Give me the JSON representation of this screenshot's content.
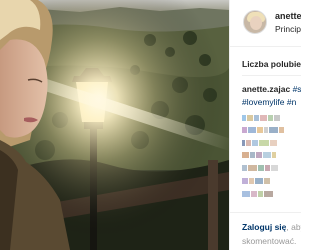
{
  "post": {
    "photo_icon": "photo",
    "header": {
      "username": "anette.z",
      "location": "Principe"
    },
    "likes_label": "Liczba polubie",
    "caption": {
      "user": "anette.zajac",
      "tag1": "#s",
      "tag2": "#lovemylife #n"
    },
    "footer": {
      "login_link": "Zaloguj się",
      "login_rest": ", aby",
      "login_line2": "skomentować."
    }
  },
  "colors": {
    "link": "#003569",
    "text": "#262626",
    "muted": "#999999"
  }
}
